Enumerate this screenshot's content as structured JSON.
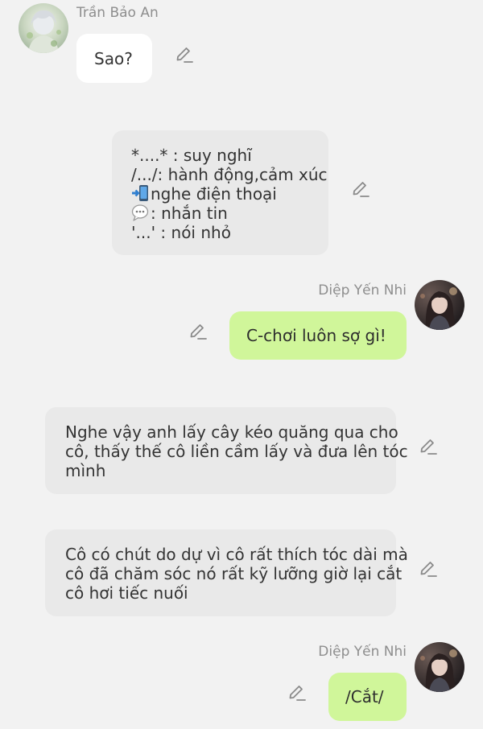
{
  "messages": [
    {
      "sender": "Trần Bảo An",
      "text": "Sao?"
    },
    {
      "legend": {
        "line1": "*....* : suy nghĩ",
        "line2": "/.../: hành động,cảm xúc",
        "line3_icon": "phone-call-icon",
        "line3": "nghe điện thoại",
        "line4_icon": "speech-bubble-icon",
        "line4": ": nhắn tin",
        "line5": "'...' : nói nhỏ"
      }
    },
    {
      "sender": "Diệp Yến Nhi",
      "text": "C-chơi luôn sợ gì!"
    },
    {
      "text_lines": [
        "Nghe vậy anh lấy cây kéo quăng qua cho",
        "cô, thấy thế cô liền cầm lấy và đưa lên tóc",
        "mình"
      ]
    },
    {
      "text_lines": [
        "Cô có chút do dự vì cô rất thích tóc dài mà",
        "cô đã chăm sóc nó rất kỹ lưỡng giờ lại cắt",
        "cô hơi tiếc nuối"
      ]
    },
    {
      "sender": "Diệp Yến Nhi",
      "text": "/Cắt/"
    }
  ],
  "colors": {
    "background": "#f2f2f2",
    "bubble_white": "#ffffff",
    "bubble_gray": "#e9e9e9",
    "bubble_green": "#d0f69a",
    "name_gray": "#8e8e8e",
    "icon_gray": "#8a8a8a"
  },
  "icons": {
    "edit": "pencil-icon",
    "avatar_left": "avatar-tran-bao-an",
    "avatar_right": "avatar-diep-yen-nhi"
  }
}
